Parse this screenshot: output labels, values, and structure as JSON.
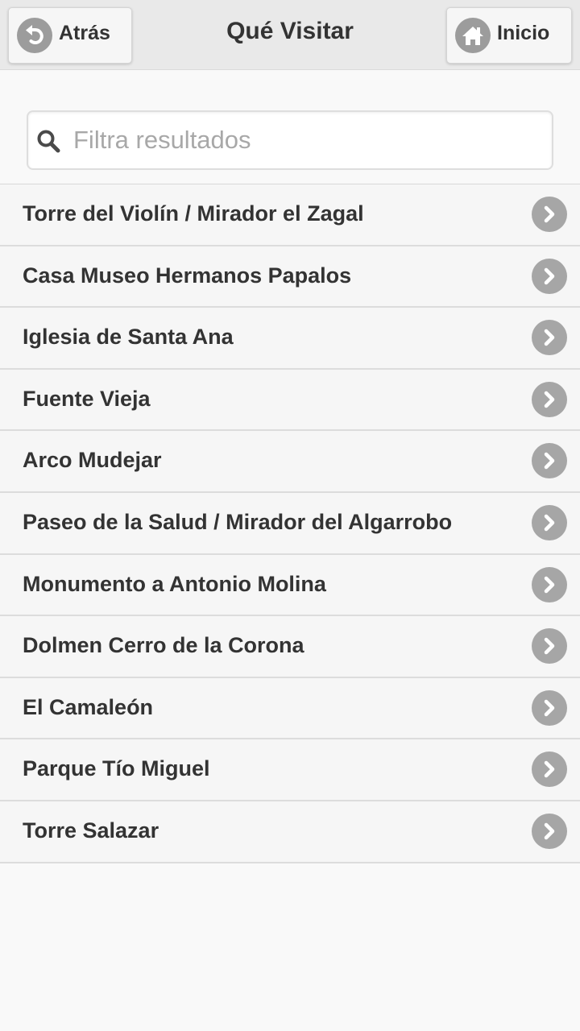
{
  "header": {
    "back_label": "Atrás",
    "back_icon": "undo-arrow-icon",
    "title": "Qué Visitar",
    "home_label": "Inicio",
    "home_icon": "home-icon"
  },
  "search": {
    "placeholder": "Filtra resultados",
    "value": "",
    "icon": "search-icon"
  },
  "list": {
    "item_icon": "chevron-right-icon",
    "items": [
      {
        "label": "Torre del Violín / Mirador el Zagal"
      },
      {
        "label": "Casa Museo Hermanos Papalos"
      },
      {
        "label": "Iglesia de Santa Ana"
      },
      {
        "label": "Fuente Vieja"
      },
      {
        "label": "Arco Mudejar"
      },
      {
        "label": "Paseo de la Salud / Mirador del Algarrobo"
      },
      {
        "label": "Monumento a Antonio Molina"
      },
      {
        "label": "Dolmen Cerro de la Corona"
      },
      {
        "label": "El Camaleón"
      },
      {
        "label": "Parque Tío Miguel"
      },
      {
        "label": "Torre Salazar"
      }
    ]
  },
  "colors": {
    "header_bg": "#e9e9e9",
    "page_bg": "#f9f9f9",
    "icon_circle": "#9c9c9c",
    "text": "#333333"
  }
}
